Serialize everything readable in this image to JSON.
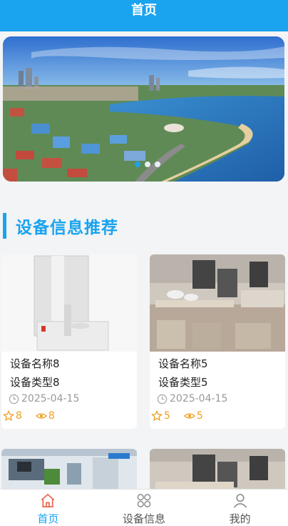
{
  "header": {
    "title": "首页"
  },
  "banner": {
    "dots": 3,
    "active_dot": 0
  },
  "section": {
    "title": "设备信息推荐"
  },
  "cards": [
    {
      "name": "设备名称8",
      "type": "设备类型8",
      "date": "2025-04-15",
      "stars": "8",
      "views": "8"
    },
    {
      "name": "设备名称5",
      "type": "设备类型5",
      "date": "2025-04-15",
      "stars": "5",
      "views": "5"
    }
  ],
  "tabbar": {
    "items": [
      {
        "label": "首页",
        "icon": "home-icon",
        "active": true
      },
      {
        "label": "设备信息",
        "icon": "grid-icon",
        "active": false
      },
      {
        "label": "我的",
        "icon": "user-icon",
        "active": false
      }
    ]
  },
  "colors": {
    "accent": "#1aa3ef",
    "stat": "#f0a020"
  }
}
